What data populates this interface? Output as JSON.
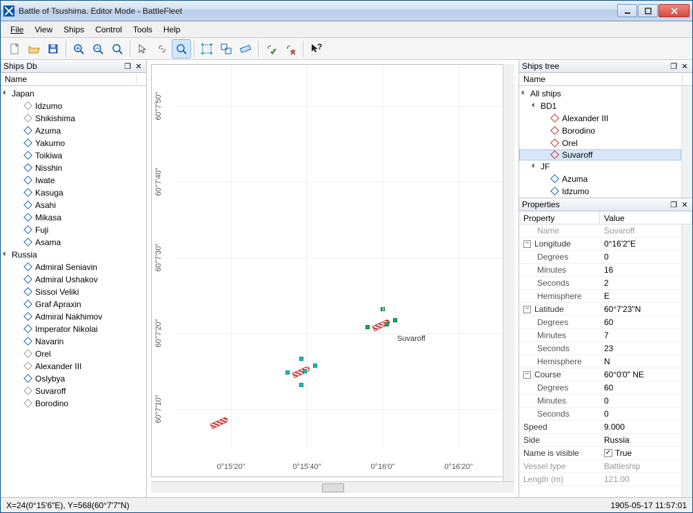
{
  "title": "Battle of Tsushima. Editor Mode - BattleFleet",
  "menu": {
    "file": "File",
    "view": "View",
    "ships": "Ships",
    "control": "Control",
    "tools": "Tools",
    "help": "Help"
  },
  "panels": {
    "shipsdb": "Ships Db",
    "shipstree": "Ships tree",
    "properties": "Properties",
    "name": "Name",
    "property": "Property",
    "value": "Value"
  },
  "shipsdb": {
    "japan": "Japan",
    "russia": "Russia",
    "jp_ships": [
      "Idzumo",
      "Shikishima",
      "Azuma",
      "Yakumo",
      "Toikiwa",
      "Nisshin",
      "Iwate",
      "Kasuga",
      "Asahi",
      "Mikasa",
      "Fuji",
      "Asama"
    ],
    "ru_ships": [
      "Admiral Seniavin",
      "Admiral Ushakov",
      "Sissoi Veliki",
      "Graf Apraxin",
      "Admiral Nakhimov",
      "Imperator Nikolai",
      "Navarin",
      "Orel",
      "Alexander III",
      "Oslybya",
      "Suvaroff",
      "Borodino"
    ]
  },
  "tree": {
    "all": "All ships",
    "bd1": "BD1",
    "jf": "JF",
    "bd1_items": [
      "Alexander III",
      "Borodino",
      "Orel",
      "Suvaroff"
    ],
    "jf_items": [
      "Azuma",
      "Idzumo"
    ]
  },
  "props": {
    "name_k": "Name",
    "name_v": "Suvaroff",
    "lon_k": "Longitude",
    "lon_v": "0°16'2\"E",
    "lat_k": "Latitude",
    "lat_v": "60°7'23\"N",
    "course_k": "Course",
    "course_v": "60°0'0\" NE",
    "deg": "Degrees",
    "min": "Minutes",
    "sec": "Seconds",
    "hemi": "Hemisphere",
    "lon_deg": "0",
    "lon_min": "16",
    "lon_sec": "2",
    "lon_hemi": "E",
    "lat_deg": "60",
    "lat_min": "7",
    "lat_sec": "23",
    "lat_hemi": "N",
    "crs_deg": "60",
    "crs_min": "0",
    "crs_sec": "0",
    "speed_k": "Speed",
    "speed_v": "9.000",
    "side_k": "Side",
    "side_v": "Russia",
    "vis_k": "Name is visible",
    "vis_v": "True",
    "vt_k": "Vessel type",
    "vt_v": "Battleship",
    "len_k": "Length (m)",
    "len_v": "121.00"
  },
  "axis_x": [
    "0°15'20\"",
    "0°15'40\"",
    "0°16'0\"",
    "0°16'20\""
  ],
  "axis_y": [
    "60°7'50\"",
    "60°7'40\"",
    "60°7'30\"",
    "60°7'20\"",
    "60°7'10\""
  ],
  "map_label": "Suvaroff",
  "status": {
    "coords": "X=24(0°15'6\"E), Y=568(60°7'7\"N)",
    "time": "1905-05-17 11:57:01"
  }
}
